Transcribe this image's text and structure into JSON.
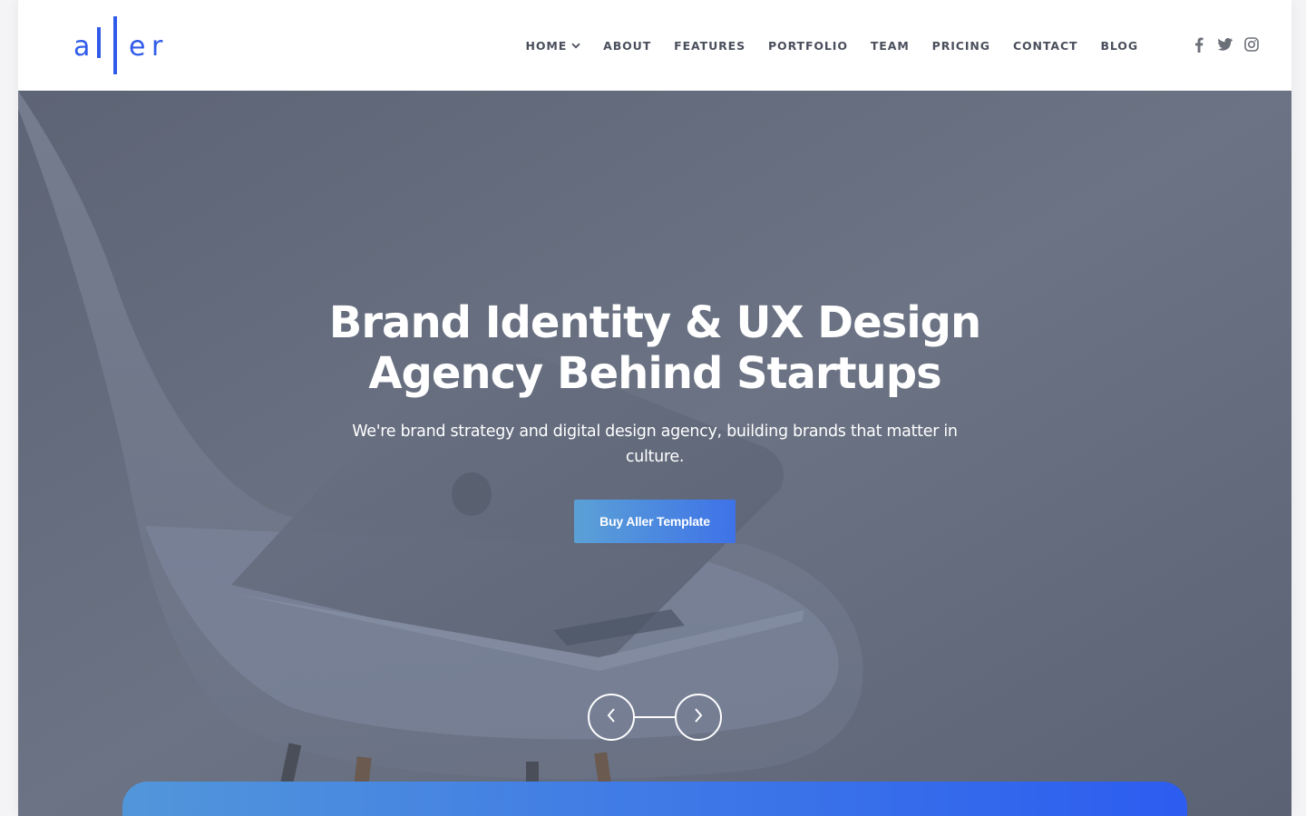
{
  "brand": {
    "logo_letters": [
      "a",
      "e",
      "r"
    ],
    "accent_color": "#2f5bea"
  },
  "nav": {
    "items": [
      {
        "label": "HOME",
        "has_dropdown": true
      },
      {
        "label": "ABOUT"
      },
      {
        "label": "FEATURES"
      },
      {
        "label": "PORTFOLIO"
      },
      {
        "label": "TEAM"
      },
      {
        "label": "PRICING"
      },
      {
        "label": "CONTACT"
      },
      {
        "label": "BLOG"
      }
    ],
    "text_color": "#4a4f5c"
  },
  "social": {
    "icons": [
      "facebook-icon",
      "twitter-icon",
      "instagram-icon"
    ],
    "color": "#6b6f78"
  },
  "hero": {
    "title_line1": "Brand Identity & UX Design",
    "title_line2": "Agency Behind Startups",
    "subtitle": "We're brand strategy and digital design agency, building brands that matter in culture.",
    "cta_label": "Buy Aller Template",
    "cta_gradient": [
      "#5ba1d6",
      "#3e72e8"
    ],
    "overlay_color": "#616a7c"
  },
  "slider": {
    "prev_icon": "chevron-left-icon",
    "next_icon": "chevron-right-icon"
  },
  "bottom_card": {
    "gradient": [
      "#5296da",
      "#2c5cf0"
    ]
  }
}
